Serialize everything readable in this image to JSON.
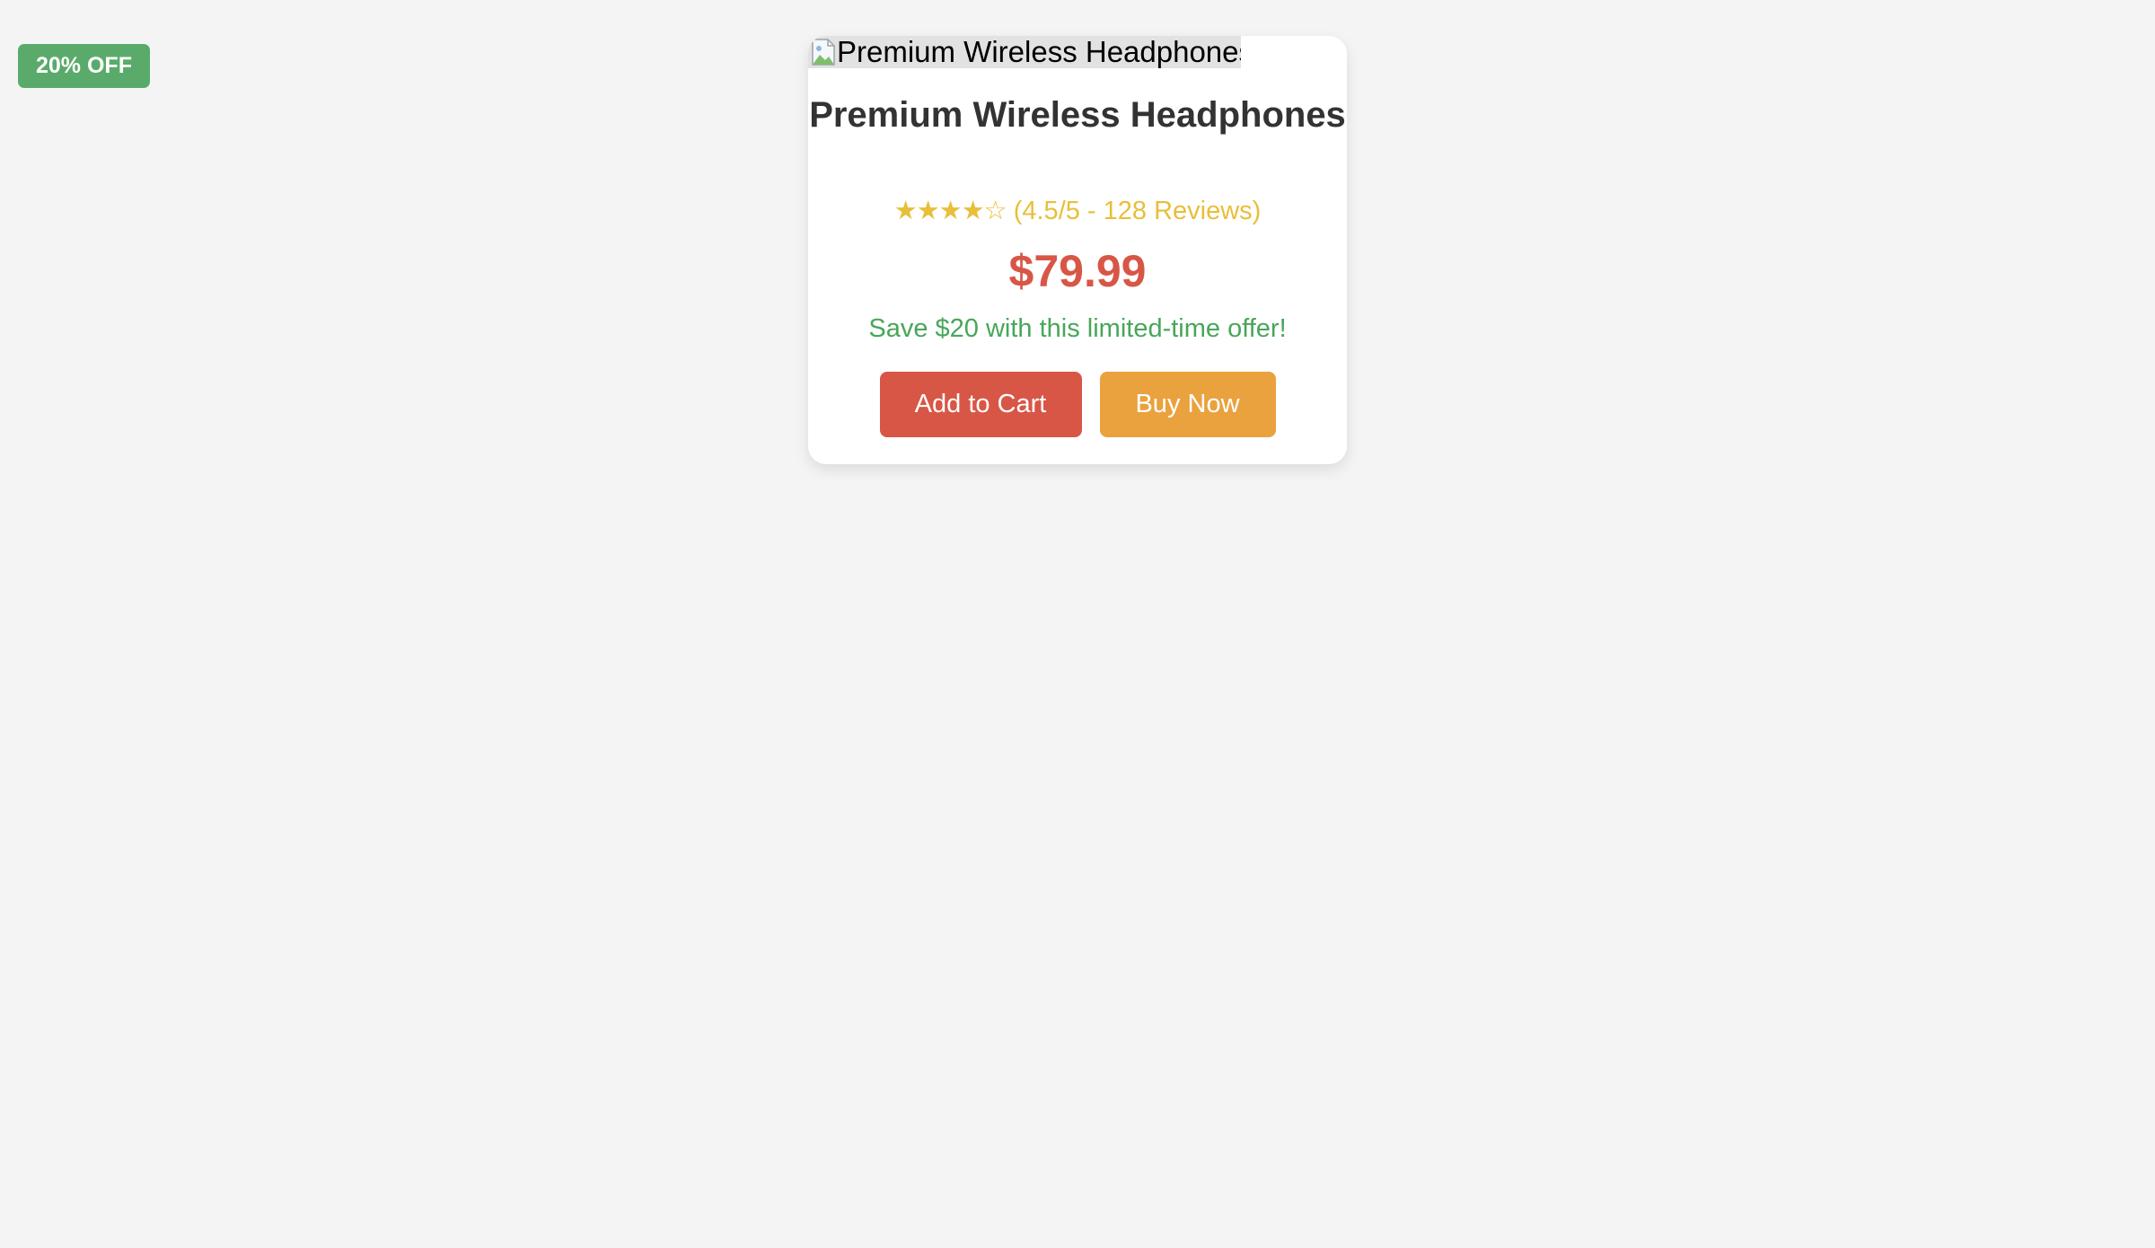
{
  "badge": {
    "label": "20% OFF",
    "color": "#5aab6b"
  },
  "product": {
    "image_alt": "Premium Wireless Headphones",
    "image_icon": "broken-image-icon",
    "title": "Premium Wireless Headphones",
    "rating": {
      "stars": "★★★★☆",
      "value": 4.5,
      "max": 5,
      "text": "(4.5/5 - 128 Reviews)"
    },
    "price": "$79.99",
    "offer": "Save $20 with this limited-time offer!"
  },
  "actions": {
    "add_to_cart": "Add to Cart",
    "buy_now": "Buy Now"
  },
  "colors": {
    "background": "#f4f4f4",
    "card": "#ffffff",
    "title": "#333333",
    "rating": "#e8bf3a",
    "price": "#d85646",
    "offer": "#48a65a",
    "add_to_cart": "#d85646",
    "buy_now": "#e9a23e"
  }
}
